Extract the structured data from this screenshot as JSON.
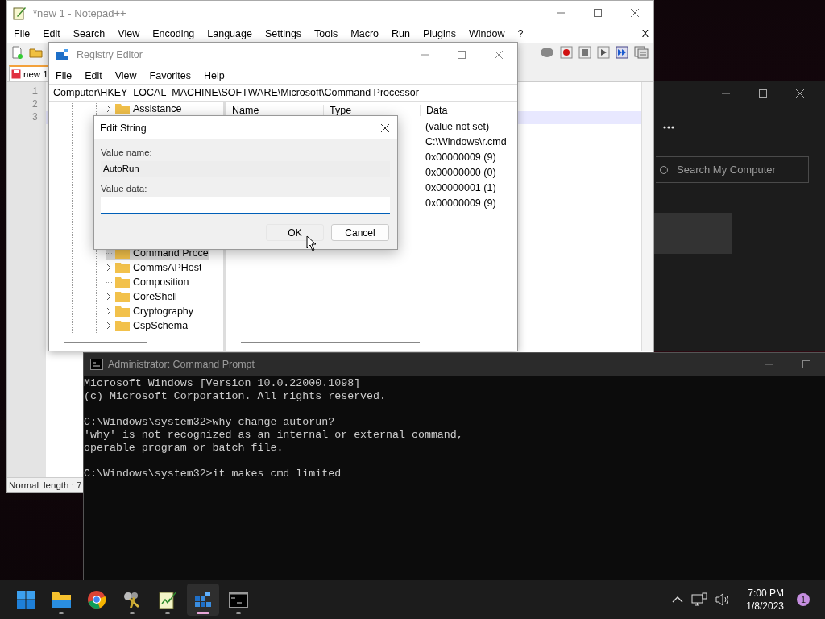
{
  "notepad": {
    "title": "*new 1 - Notepad++",
    "menu": [
      "File",
      "Edit",
      "Search",
      "View",
      "Encoding",
      "Language",
      "Settings",
      "Tools",
      "Macro",
      "Run",
      "Plugins",
      "Window",
      "?"
    ],
    "close_document": "X",
    "tab": "new 1",
    "lines": [
      {
        "number": "1",
        "current": false
      },
      {
        "number": "2",
        "current": false
      },
      {
        "number": "3",
        "current": true
      }
    ],
    "status": [
      "Normal",
      "length : 7"
    ]
  },
  "background_app": {
    "search": {
      "placeholder": "Search My Computer"
    }
  },
  "registry_editor": {
    "title": "Registry Editor",
    "menu": [
      "File",
      "Edit",
      "View",
      "Favorites",
      "Help"
    ],
    "address": "Computer\\HKEY_LOCAL_MACHINE\\SOFTWARE\\Microsoft\\Command Processor",
    "tree_top": [
      {
        "label": "Assistance",
        "expandable": true,
        "selected": false
      }
    ],
    "tree_bottom": [
      {
        "label": "Command Proce",
        "expandable": false,
        "selected": true
      },
      {
        "label": "CommsAPHost",
        "expandable": true,
        "selected": false
      },
      {
        "label": "Composition",
        "expandable": false,
        "selected": false
      },
      {
        "label": "CoreShell",
        "expandable": true,
        "selected": false
      },
      {
        "label": "Cryptography",
        "expandable": true,
        "selected": false
      },
      {
        "label": "CspSchema",
        "expandable": true,
        "selected": false
      }
    ],
    "columns": [
      "Name",
      "Type",
      "Data"
    ],
    "data": [
      "(value not set)",
      "C:\\Windows\\r.cmd",
      "0x00000009 (9)",
      "0x00000000 (0)",
      "0x00000001 (1)",
      "0x00000009 (9)"
    ]
  },
  "edit_string": {
    "title": "Edit String",
    "value_name_label": "Value name:",
    "value_name": "AutoRun",
    "value_data_label": "Value data:",
    "buttons": [
      "OK",
      "Cancel"
    ]
  },
  "command_prompt": {
    "title": "Administrator: Command Prompt",
    "blocks": [
      [
        "Microsoft Windows [Version 10.0.22000.1098]",
        "(c) Microsoft Corporation. All rights reserved."
      ],
      [
        "C:\\Windows\\system32>why change autorun?",
        "'why' is not recognized as an internal or external command,",
        "operable program or batch file."
      ],
      [
        "C:\\Windows\\system32>it makes cmd limited"
      ]
    ]
  },
  "taskbar": {
    "apps": [
      {
        "kind": "start",
        "selected": false,
        "running": false
      },
      {
        "kind": "folder",
        "selected": false,
        "running": true
      },
      {
        "kind": "browser",
        "selected": false,
        "running": false
      },
      {
        "kind": "keys",
        "selected": false,
        "running": true
      },
      {
        "kind": "notepad",
        "selected": false,
        "running": true
      },
      {
        "kind": "registry",
        "selected": true,
        "running": true
      },
      {
        "kind": "terminal",
        "selected": false,
        "running": true
      }
    ],
    "time": "7:00 PM",
    "date": "1/8/2023",
    "notifications": "1"
  }
}
